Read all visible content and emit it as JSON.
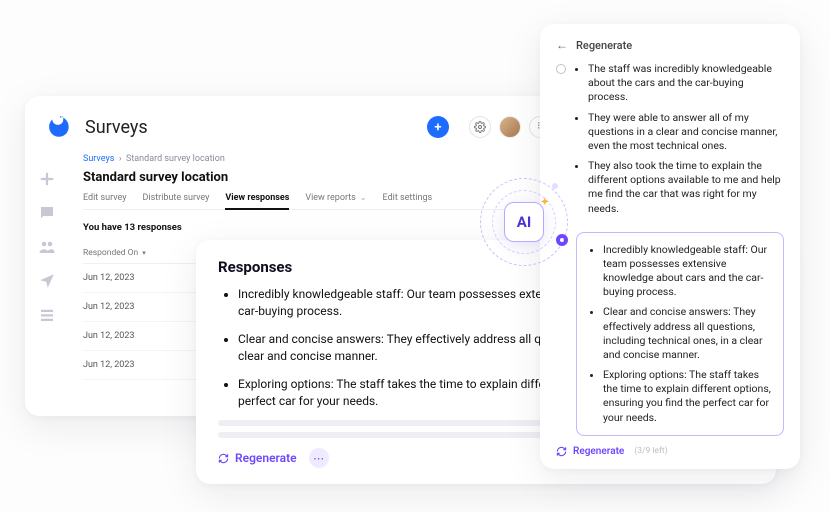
{
  "app_title": "Surveys",
  "header_icons": {
    "add": "+",
    "gear": "⚙",
    "drag": "⠿"
  },
  "breadcrumb": {
    "root": "Surveys",
    "current": "Standard survey location"
  },
  "page_title": "Standard survey location",
  "tabs": {
    "edit_survey": "Edit survey",
    "distribute": "Distribute survey",
    "view_responses": "View responses",
    "view_reports": "View reports",
    "edit_settings": "Edit settings"
  },
  "responses_summary": "You have 13 responses",
  "table": {
    "header": "Responded On",
    "rows": [
      "Jun 12, 2023",
      "Jun 12, 2023",
      "Jun 12, 2023",
      "Jun 12, 2023"
    ]
  },
  "front_panel": {
    "title": "Responses",
    "bullets": [
      "Incredibly knowledgeable staff: Our team possesses extensive knowledge about cars and the car-buying process.",
      "Clear and concise answers: They effectively address all questions, including technical ones, in a clear and concise manner.",
      "Exploring options: The staff takes the time to explain different options, ensuring you find the perfect car for your needs."
    ],
    "regenerate_label": "Regenerate",
    "more": "⋯"
  },
  "right_panel": {
    "title": "Regenerate",
    "option_a": [
      "The staff was incredibly knowledgeable about the cars and the car-buying process.",
      "They were able to answer all of my questions in a clear and concise manner, even the most technical ones.",
      "They also took the time to explain the different options available to me and help me find the car that was right for my needs."
    ],
    "option_b": [
      "Incredibly knowledgeable staff: Our team possesses extensive knowledge about cars and the car-buying process.",
      "Clear and concise answers: They effectively address all questions, including technical ones, in a clear and concise manner.",
      "Exploring options: The staff takes the time to explain different options, ensuring you find the perfect car for your needs."
    ],
    "regenerate_label": "Regenerate",
    "count_left": "(3/9 left)"
  },
  "ai_label": "AI"
}
